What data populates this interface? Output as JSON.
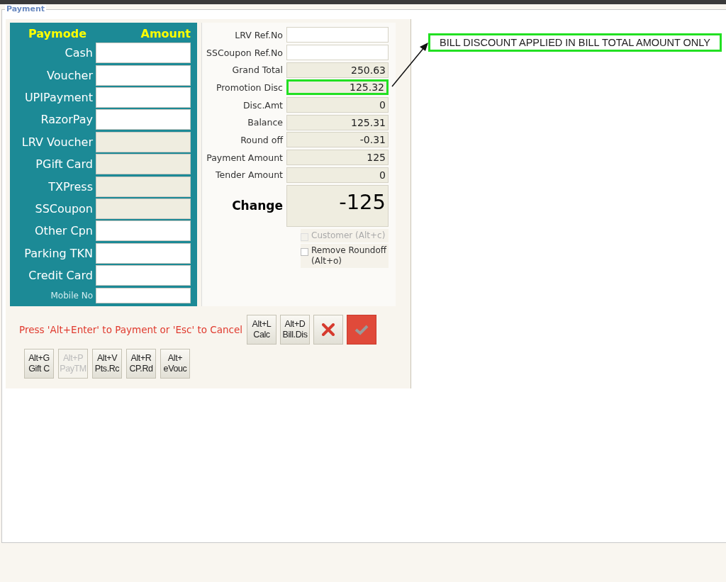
{
  "window": {
    "title": "Payment"
  },
  "paymodes": {
    "header_mode": "Paymode",
    "header_amount": "Amount",
    "rows": [
      {
        "label": "Cash",
        "enabled": true,
        "kind": "large"
      },
      {
        "label": "Voucher",
        "enabled": true,
        "kind": "large"
      },
      {
        "label": "UPIPayment",
        "enabled": true,
        "kind": "large"
      },
      {
        "label": "RazorPay",
        "enabled": true,
        "kind": "large"
      },
      {
        "label": "LRV Voucher",
        "enabled": false,
        "kind": "large"
      },
      {
        "label": "PGift Card",
        "enabled": false,
        "kind": "large"
      },
      {
        "label": "TXPress",
        "enabled": false,
        "kind": "large"
      },
      {
        "label": "SSCoupon",
        "enabled": false,
        "kind": "large"
      },
      {
        "label": "Other Cpn",
        "enabled": true,
        "kind": "large"
      },
      {
        "label": "Parking TKN",
        "enabled": true,
        "kind": "large"
      },
      {
        "label": "Credit Card",
        "enabled": true,
        "kind": "large"
      },
      {
        "label": "Mobile No",
        "enabled": true,
        "kind": "small"
      }
    ]
  },
  "totals": [
    {
      "label": "LRV Ref.No",
      "editable": true,
      "highlighted": false
    },
    {
      "label": "SSCoupon Ref.No",
      "editable": true,
      "highlighted": false
    },
    {
      "label": "Grand Total",
      "value": "250.63",
      "editable": false,
      "highlighted": false
    },
    {
      "label": "Promotion Disc",
      "value": "125.32",
      "editable": false,
      "highlighted": true
    },
    {
      "label": "Disc.Amt",
      "value": "0",
      "editable": false,
      "highlighted": false
    },
    {
      "label": "Balance",
      "value": "125.31",
      "editable": false,
      "highlighted": false
    },
    {
      "label": "Round off",
      "value": "-0.31",
      "editable": false,
      "highlighted": false
    },
    {
      "label": "Payment Amount",
      "value": "125",
      "editable": false,
      "highlighted": false
    },
    {
      "label": "Tender Amount",
      "value": "0",
      "editable": false,
      "highlighted": false
    }
  ],
  "change": {
    "label": "Change",
    "value": "-125"
  },
  "checkboxes": [
    {
      "label": "Customer (Alt+c)",
      "checked": false,
      "disabled": true
    },
    {
      "label": "Remove Roundoff (Alt+o)",
      "checked": false,
      "disabled": false
    }
  ],
  "hint": "Press 'Alt+Enter' to Payment or 'Esc' to Cancel",
  "action_buttons": [
    {
      "kind": "text",
      "line1": "Alt+L",
      "line2": "Calc"
    },
    {
      "kind": "text",
      "line1": "Alt+D",
      "line2": "Bill.Dis"
    },
    {
      "kind": "cancel"
    },
    {
      "kind": "confirm"
    }
  ],
  "shortcut_buttons": [
    {
      "line1": "Alt+G",
      "line2": "Gift C",
      "disabled": false
    },
    {
      "line1": "Alt+P",
      "line2": "PayTM",
      "disabled": true
    },
    {
      "line1": "Alt+V",
      "line2": "Pts.Rc",
      "disabled": false
    },
    {
      "line1": "Alt+R",
      "line2": "CP.Rd",
      "disabled": false
    },
    {
      "line1": "Alt+",
      "line2": "eVouc",
      "disabled": false
    }
  ],
  "callout": {
    "text": "BILL DISCOUNT APPLIED IN BILL TOTAL AMOUNT ONLY"
  }
}
